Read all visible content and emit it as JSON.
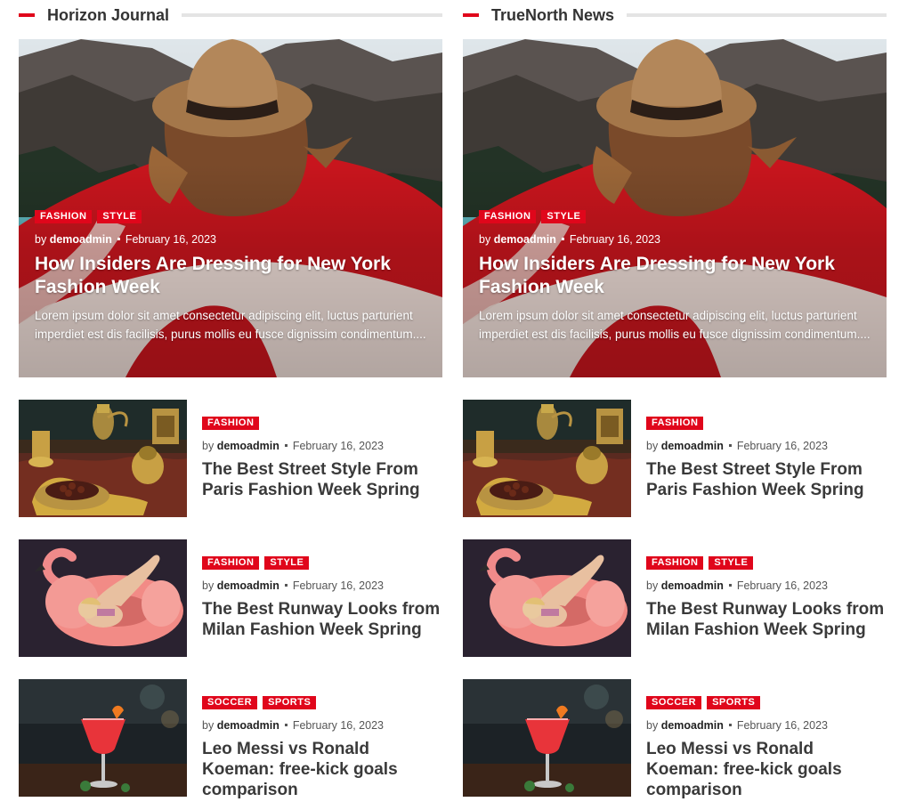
{
  "columns": [
    {
      "title": "Horizon Journal",
      "hero": {
        "tags": [
          "FASHION",
          "STYLE"
        ],
        "by": "by",
        "author": "demoadmin",
        "date": "February 16, 2023",
        "headline": "How Insiders Are Dressing for New York Fashion Week",
        "excerpt": "Lorem ipsum dolor sit amet consectetur adipiscing elit, luctus parturient imperdiet est dis facilisis, purus mollis eu fusce dignissim condimentum...."
      },
      "items": [
        {
          "tags": [
            "FASHION"
          ],
          "by": "by",
          "author": "demoadmin",
          "date": "February 16, 2023",
          "headline": "The Best Street Style From Paris Fashion Week Spring"
        },
        {
          "tags": [
            "FASHION",
            "STYLE"
          ],
          "by": "by",
          "author": "demoadmin",
          "date": "February 16, 2023",
          "headline": "The Best Runway Looks from Milan Fashion Week Spring"
        },
        {
          "tags": [
            "SOCCER",
            "SPORTS"
          ],
          "by": "by",
          "author": "demoadmin",
          "date": "February 16, 2023",
          "headline": "Leo Messi vs Ronald Koeman: free-kick goals comparison"
        }
      ]
    },
    {
      "title": "TrueNorth News",
      "hero": {
        "tags": [
          "FASHION",
          "STYLE"
        ],
        "by": "by",
        "author": "demoadmin",
        "date": "February 16, 2023",
        "headline": "How Insiders Are Dressing for New York Fashion Week",
        "excerpt": "Lorem ipsum dolor sit amet consectetur adipiscing elit, luctus parturient imperdiet est dis facilisis, purus mollis eu fusce dignissim condimentum...."
      },
      "items": [
        {
          "tags": [
            "FASHION"
          ],
          "by": "by",
          "author": "demoadmin",
          "date": "February 16, 2023",
          "headline": "The Best Street Style From Paris Fashion Week Spring"
        },
        {
          "tags": [
            "FASHION",
            "STYLE"
          ],
          "by": "by",
          "author": "demoadmin",
          "date": "February 16, 2023",
          "headline": "The Best Runway Looks from Milan Fashion Week Spring"
        },
        {
          "tags": [
            "SOCCER",
            "SPORTS"
          ],
          "by": "by",
          "author": "demoadmin",
          "date": "February 16, 2023",
          "headline": "Leo Messi vs Ronald Koeman: free-kick goals comparison"
        }
      ]
    }
  ],
  "colors": {
    "accent": "#e0061b",
    "heading": "#3a3a3a",
    "rule": "#e4e4e4"
  }
}
